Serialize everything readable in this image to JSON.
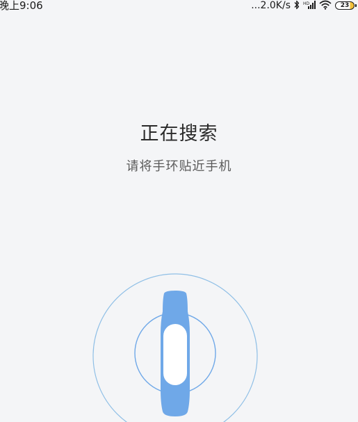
{
  "status_bar": {
    "time": "晚上9:06",
    "network_speed": "...2.0K/s",
    "battery_level": "23",
    "icons": [
      "bluetooth-icon",
      "signal-icon",
      "wifi-icon",
      "battery-icon"
    ]
  },
  "search": {
    "title": "正在搜索",
    "instruction": "请将手环贴近手机"
  },
  "colors": {
    "background": "#f4f5f7",
    "band": "#6fa8e8",
    "ring": "#8fbfe6",
    "battery_accent": "#f3c03a"
  },
  "graphic": {
    "device_icon": "fitness-band-icon"
  }
}
